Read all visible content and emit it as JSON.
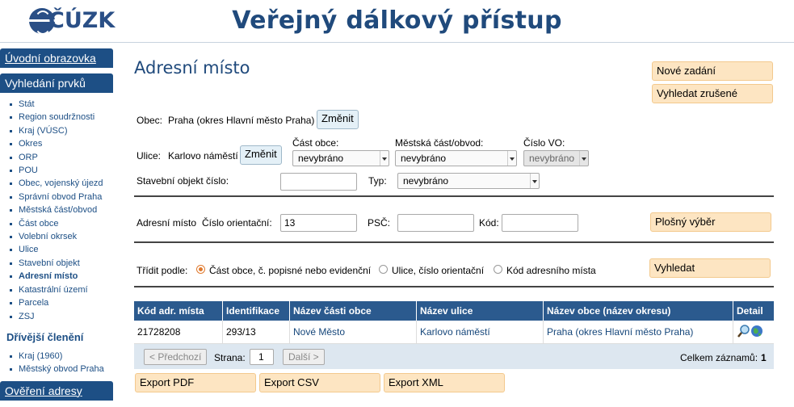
{
  "header": {
    "logo_text": "ČÚZK",
    "title": "Veřejný dálkový přístup"
  },
  "sidebar": {
    "home": "Úvodní obrazovka",
    "search_head": "Vyhledání prvků",
    "items": [
      "Stát",
      "Region soudržnosti",
      "Kraj (VÚSC)",
      "Okres",
      "ORP",
      "POU",
      "Obec, vojenský újezd",
      "Správní obvod Praha",
      "Městská část/obvod",
      "Část obce",
      "Volební okrsek",
      "Ulice",
      "Stavební objekt",
      "Adresní místo",
      "Katastrální území",
      "Parcela",
      "ZSJ"
    ],
    "previous_head": "Dřívější členění",
    "previous_items": [
      "Kraj (1960)",
      "Městský obvod Praha"
    ],
    "verify": "Ověření adresy"
  },
  "main": {
    "title": "Adresní místo",
    "new_entry": "Nové zadání",
    "search_cancelled": "Vyhledat zrušené",
    "obec_label": "Obec:",
    "obec_value": "Praha (okres Hlavní město Praha)",
    "change": "Změnit",
    "ulice_label": "Ulice:",
    "ulice_value": "Karlovo náměstí",
    "cast_obce_label": "Část obce:",
    "cast_obce_value": "nevybráno",
    "mestska_cast_label": "Městská část/obvod:",
    "mestska_cast_value": "nevybráno",
    "cislo_vo_label": "Číslo VO:",
    "cislo_vo_value": "nevybráno",
    "stavebni_label": "Stavební objekt číslo:",
    "stavebni_value": "",
    "typ_label": "Typ:",
    "typ_value": "nevybráno",
    "adresni_label": "Adresní místo",
    "cislo_or_label": "Číslo orientační:",
    "cislo_or_value": "13",
    "psc_label": "PSČ:",
    "psc_value": "",
    "kod_label": "Kód:",
    "kod_value": "",
    "area_select": "Plošný výběr",
    "sort_label": "Třídit podle:",
    "sort_options": [
      "Část obce, č. popisné nebo evidenční",
      "Ulice, číslo orientační",
      "Kód adresního místa"
    ],
    "search": "Vyhledat"
  },
  "table": {
    "headers": [
      "Kód adr. místa",
      "Identifikace",
      "Název části obce",
      "Název ulice",
      "Název obce (název okresu)",
      "Detail"
    ],
    "rows": [
      [
        "21728208",
        "293/13",
        "Nové Město",
        "Karlovo náměstí",
        "Praha (okres Hlavní město Praha)"
      ]
    ],
    "prev": "< Předchozí",
    "page_label": "Strana:",
    "page_value": "1",
    "next": "Další >",
    "total_label": "Celkem záznamů:",
    "total_value": "1"
  },
  "exports": [
    "Export PDF",
    "Export CSV",
    "Export XML"
  ]
}
